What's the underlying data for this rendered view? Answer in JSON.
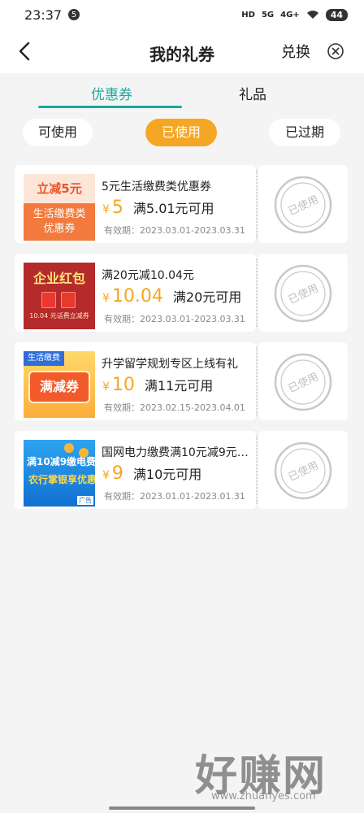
{
  "status_bar": {
    "time": "23:37",
    "notification_count": "5",
    "network_hd": "HD",
    "network_5g": "5G",
    "network_4g": "4G+",
    "battery": "44"
  },
  "header": {
    "title": "我的礼券",
    "exchange_label": "兑换"
  },
  "tabs": [
    {
      "label": "优惠券",
      "active": true
    },
    {
      "label": "礼品",
      "active": false
    }
  ],
  "filters": [
    {
      "label": "可使用",
      "selected": false
    },
    {
      "label": "已使用",
      "selected": true
    },
    {
      "label": "已过期",
      "selected": false
    }
  ],
  "stamp_text": "已使用",
  "coupons": [
    {
      "name": "5元生活缴费类优惠券",
      "currency": "¥",
      "amount": "5",
      "condition": "满5.01元可用",
      "validity": "有效期：2023.03.01-2023.03.31",
      "thumb": {
        "line1": "立减5元",
        "line2": "生活缴费类",
        "line3": "优惠券"
      }
    },
    {
      "name": "满20元减10.04元",
      "currency": "¥",
      "amount": "10.04",
      "condition": "满20元可用",
      "validity": "有效期：2023.03.01-2023.03.31",
      "thumb": {
        "line1": "企业红包",
        "line2": "10.04 元话费立减券"
      }
    },
    {
      "name": "升学留学规划专区上线有礼",
      "currency": "¥",
      "amount": "10",
      "condition": "满11元可用",
      "validity": "有效期：2023.02.15-2023.04.01",
      "thumb": {
        "line1": "生活缴费",
        "line2": "满减券"
      }
    },
    {
      "name": "国网电力缴费满10元减9元…",
      "currency": "¥",
      "amount": "9",
      "condition": "满10元可用",
      "validity": "有效期：2023.01.01-2023.01.31",
      "thumb": {
        "line1": "满10减9缴电费",
        "line2": "农行掌银享优惠",
        "line3": "广告"
      }
    }
  ],
  "watermark": {
    "text": "好赚网",
    "url": "www.zhuanyes.com"
  },
  "colors": {
    "accent": "#1aa99c",
    "orange": "#f5a623"
  }
}
